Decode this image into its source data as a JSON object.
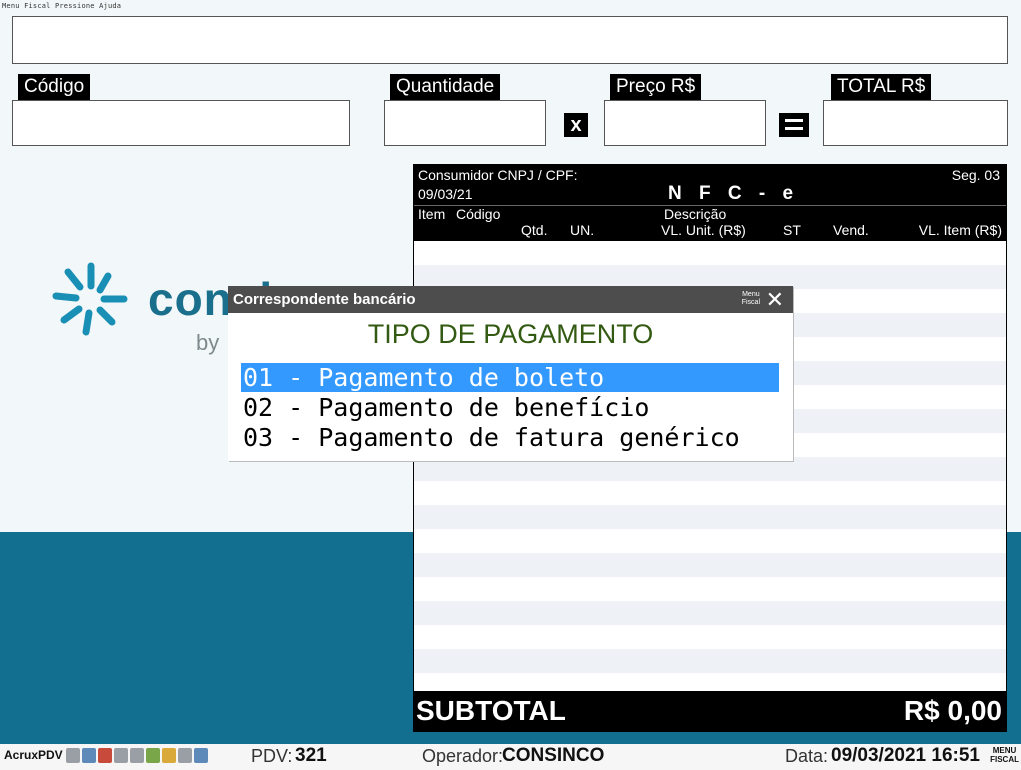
{
  "window": {
    "top_strip": "Menu Fiscal Pressione Ajuda"
  },
  "fields": {
    "codigo_label": "Código",
    "quantidade_label": "Quantidade",
    "preco_label": "Preço R$",
    "total_label": "TOTAL R$",
    "multiply_sign": "x"
  },
  "logo": {
    "name": "consinco",
    "by": "by"
  },
  "receipt": {
    "consumer_label": "Consumidor CNPJ / CPF:",
    "seg": "Seg. 03",
    "date": "09/03/21",
    "title": "N F C - e",
    "columns": {
      "item": "Item",
      "codigo": "Código",
      "descricao": "Descrição",
      "qtd": "Qtd.",
      "un": "UN.",
      "vl_unit": "VL. Unit. (R$)",
      "st": "ST",
      "vend": "Vend.",
      "vl_item": "VL. Item (R$)"
    },
    "subtotal_label": "SUBTOTAL",
    "subtotal_value": "R$ 0,00"
  },
  "dialog": {
    "title": "Correspondente bancário",
    "menu_label_1": "Menu",
    "menu_label_2": "Fiscal",
    "close_icon": "close-icon",
    "heading": "TIPO DE PAGAMENTO",
    "options": [
      {
        "label": "01 - Pagamento de boleto",
        "selected": true
      },
      {
        "label": "02 - Pagamento de benefício",
        "selected": false
      },
      {
        "label": "03 - Pagamento de fatura genérico",
        "selected": false
      }
    ]
  },
  "status": {
    "app": "AcruxPDV",
    "pdv_label": "PDV:",
    "pdv_value": "321",
    "operator_label": "Operador:",
    "operator_value": "CONSINCO",
    "date_label": "Data:",
    "date_value": "09/03/2021 16:51",
    "menu_label_1": "MENU",
    "menu_label_2": "FISCAL"
  },
  "colors": {
    "band": "#136f90",
    "selection": "#3399ff",
    "heading": "#335a12",
    "logo": "#1a6f8c"
  }
}
